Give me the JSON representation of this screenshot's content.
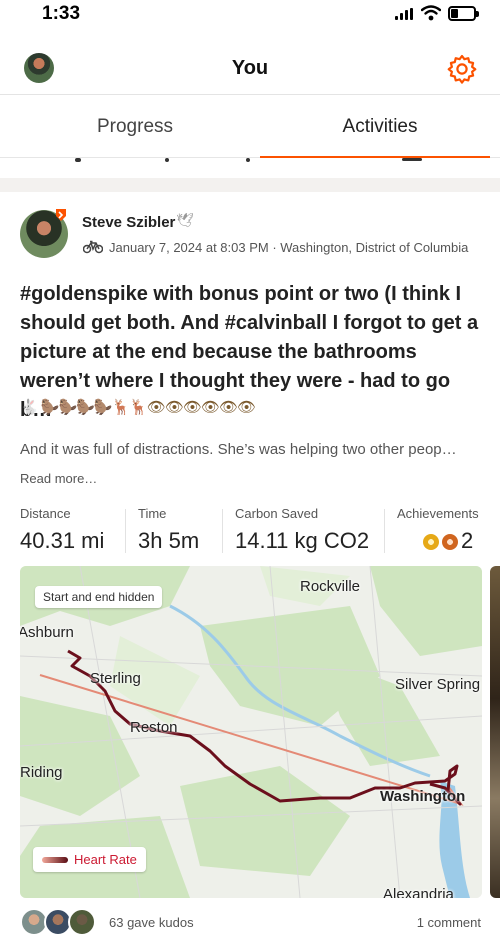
{
  "status_bar": {
    "time": "1:33"
  },
  "header": {
    "title": "You",
    "settings_icon": "gear-icon",
    "accent_color": "#fc5200"
  },
  "tabs": [
    {
      "label": "Progress",
      "selected": false
    },
    {
      "label": "Activities",
      "selected": true
    }
  ],
  "activity": {
    "athlete_name": "Steve Szibler",
    "name_emoji": "🕊",
    "activity_icon": "bike-icon",
    "meta": "January 7, 2024 at 8:03 PM · Washington, District of Columbia",
    "title": "#goldenspike with bonus point or two (I think I should get both. And #calvinball I forgot to get a picture at the end because the bathrooms weren’t where I thought they were - had to go b…",
    "emoji_line": "🐇 🦫🦫🦫🦫🦌🦌👁👁👁👁👁👁",
    "description": "And it was full of distractions. She’s  was helping two other peop…",
    "read_more": "Read more…",
    "stats": [
      {
        "label": "Distance",
        "value": "40.31 mi"
      },
      {
        "label": "Time",
        "value": "3h 5m"
      },
      {
        "label": "Carbon Saved",
        "value": "14.11 kg CO2"
      },
      {
        "label": "Achievements",
        "value": "2"
      }
    ],
    "map": {
      "privacy_label": "Start and end hidden",
      "places": [
        "Rockville",
        "Ashburn",
        "Sterling",
        "Silver Spring",
        "Reston",
        "Riding",
        "Washington",
        "Alexandria"
      ],
      "legend": "Heart Rate"
    },
    "kudos": "63 gave kudos",
    "comments": "1 comment"
  }
}
